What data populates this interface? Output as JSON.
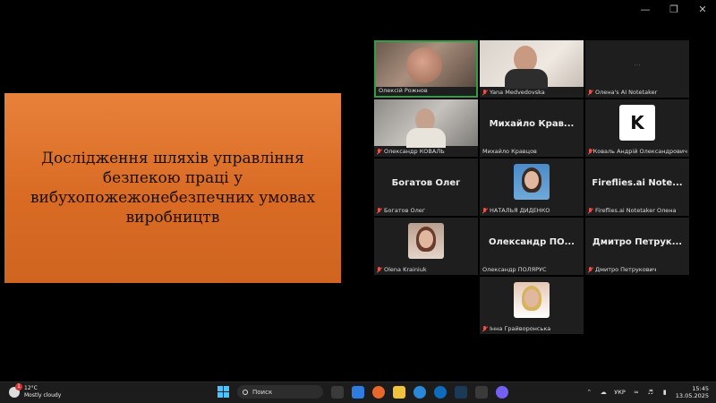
{
  "slide": {
    "title": "Дослідження шляхів управління безпекою праці у вибухопожежонебезпечних умовах виробництв"
  },
  "participants": [
    {
      "label": "Олексій Рожнов",
      "type": "video"
    },
    {
      "label": "Yana Medvedovska",
      "type": "video"
    },
    {
      "label": "Олена's AI Notetaker",
      "type": "video"
    },
    {
      "label": "Олександр КОВАЛЬ",
      "type": "video"
    },
    {
      "label": "Михайло Кравцов",
      "display_name": "Михайло Крав...",
      "type": "name"
    },
    {
      "label": "Коваль Андрій Олександрович",
      "type": "avatar"
    },
    {
      "label": "Богатов Олег",
      "display_name": "Богатов Олег",
      "type": "name"
    },
    {
      "label": "НАТАЛЬЯ ДИДЕНКО",
      "type": "avatar"
    },
    {
      "label": "Fireflies.ai Notetaker Олена",
      "display_name": "Fireflies.ai  Note...",
      "type": "name"
    },
    {
      "label": "Olena Krainiuk",
      "type": "avatar"
    },
    {
      "label": "Олександр ПОЛЯРУС",
      "display_name": "Олександр  ПО...",
      "type": "name"
    },
    {
      "label": "Дмитро Петрукович",
      "display_name": "Дмитро  Петрук...",
      "type": "name"
    },
    {
      "label": "Інна Грайворонська",
      "type": "avatar"
    }
  ],
  "taskbar": {
    "temperature": "12°C",
    "weather": "Mostly cloudy",
    "search_placeholder": "Поиск",
    "language": "УКР",
    "time": "15:45",
    "date": "13.05.2025"
  },
  "colors": {
    "slide_gradient_top": "#e8813a",
    "slide_gradient_bottom": "#cf6520",
    "active_speaker_border": "#2ea043",
    "muted_mic": "#e5534b"
  }
}
